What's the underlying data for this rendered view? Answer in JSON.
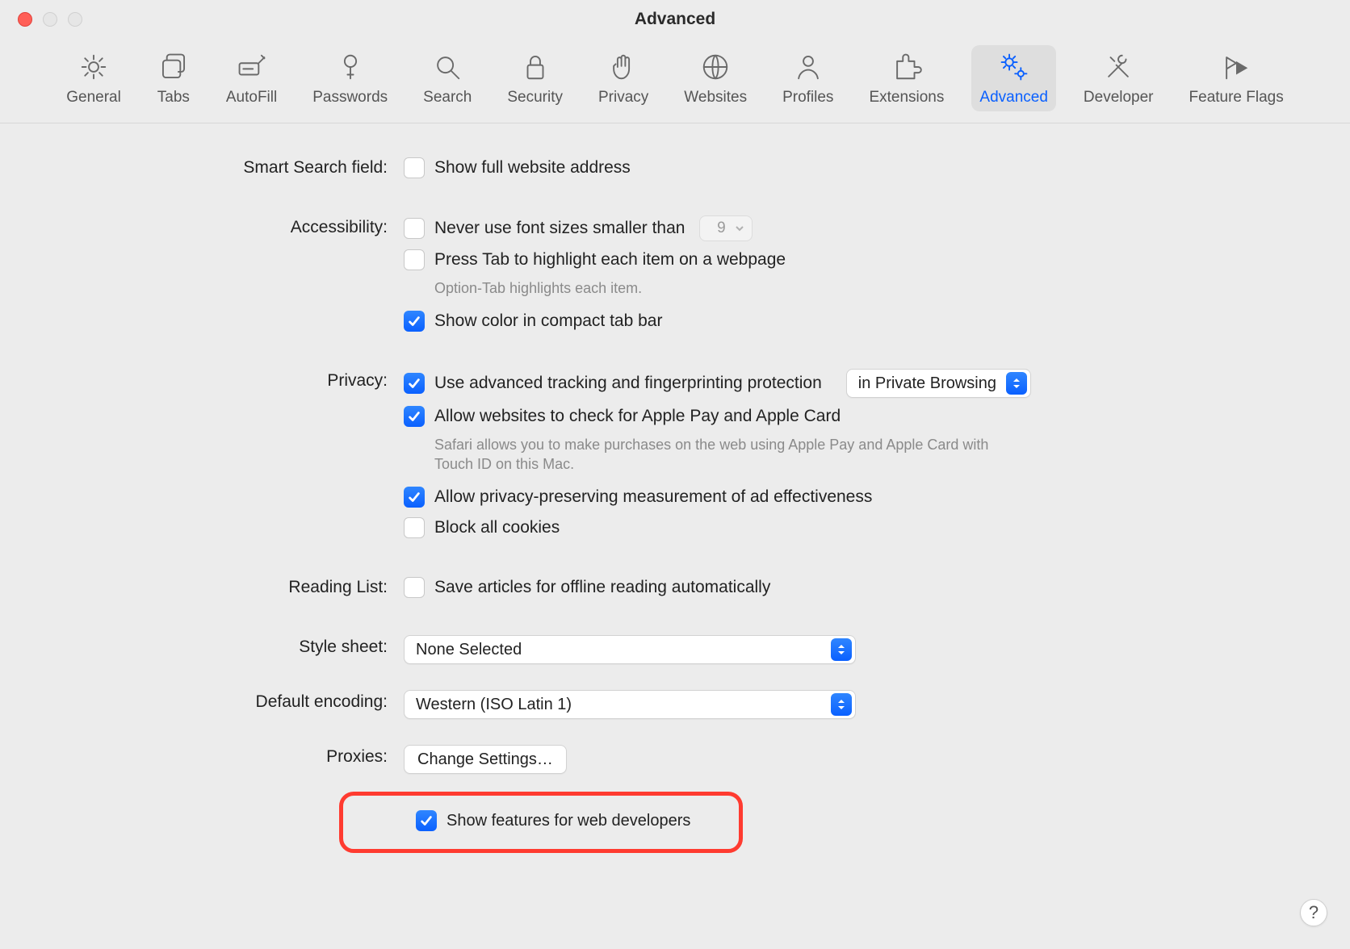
{
  "window": {
    "title": "Advanced"
  },
  "toolbar": {
    "items": [
      {
        "label": "General"
      },
      {
        "label": "Tabs"
      },
      {
        "label": "AutoFill"
      },
      {
        "label": "Passwords"
      },
      {
        "label": "Search"
      },
      {
        "label": "Security"
      },
      {
        "label": "Privacy"
      },
      {
        "label": "Websites"
      },
      {
        "label": "Profiles"
      },
      {
        "label": "Extensions"
      },
      {
        "label": "Advanced"
      },
      {
        "label": "Developer"
      },
      {
        "label": "Feature Flags"
      }
    ],
    "selected_index": 10
  },
  "sections": {
    "smart_search": {
      "label": "Smart Search field:",
      "show_full_url": {
        "label": "Show full website address",
        "checked": false
      }
    },
    "accessibility": {
      "label": "Accessibility:",
      "min_font": {
        "label": "Never use font sizes smaller than",
        "checked": false,
        "value": "9"
      },
      "press_tab": {
        "label": "Press Tab to highlight each item on a webpage",
        "checked": false
      },
      "press_tab_helper": "Option-Tab highlights each item.",
      "compact_color": {
        "label": "Show color in compact tab bar",
        "checked": true
      }
    },
    "privacy": {
      "label": "Privacy:",
      "tracking": {
        "label": "Use advanced tracking and fingerprinting protection",
        "checked": true,
        "select_value": "in Private Browsing"
      },
      "applepay": {
        "label": "Allow websites to check for Apple Pay and Apple Card",
        "checked": true
      },
      "applepay_helper": "Safari allows you to make purchases on the web using Apple Pay and Apple Card with Touch ID on this Mac.",
      "ad_measure": {
        "label": "Allow privacy-preserving measurement of ad effectiveness",
        "checked": true
      },
      "block_cookies": {
        "label": "Block all cookies",
        "checked": false
      }
    },
    "reading_list": {
      "label": "Reading List:",
      "offline": {
        "label": "Save articles for offline reading automatically",
        "checked": false
      }
    },
    "style_sheet": {
      "label": "Style sheet:",
      "value": "None Selected"
    },
    "default_encoding": {
      "label": "Default encoding:",
      "value": "Western (ISO Latin 1)"
    },
    "proxies": {
      "label": "Proxies:",
      "button": "Change Settings…"
    },
    "dev_features": {
      "label": "Show features for web developers",
      "checked": true
    }
  },
  "help": "?"
}
